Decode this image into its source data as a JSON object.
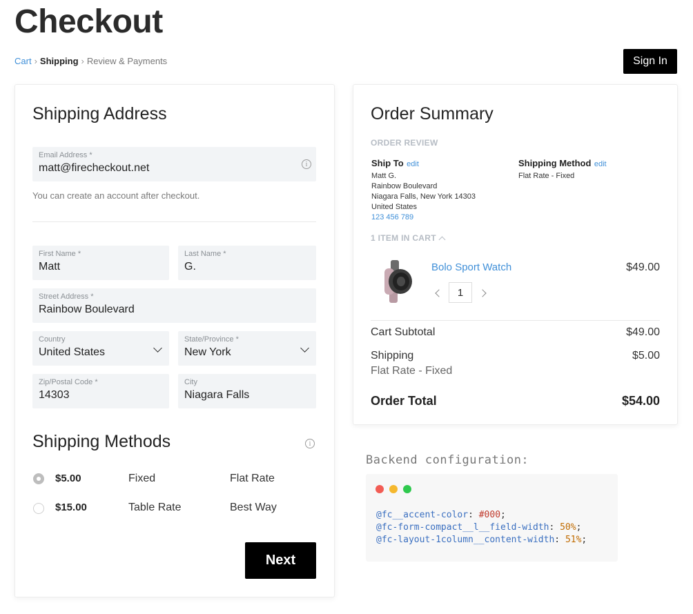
{
  "page": {
    "title": "Checkout",
    "breadcrumb": {
      "cart": "Cart",
      "shipping": "Shipping",
      "review": "Review & Payments",
      "sep": "›"
    },
    "signin_label": "Sign In"
  },
  "shipping_address": {
    "heading": "Shipping Address",
    "email": {
      "label": "Email Address *",
      "value": "matt@firecheckout.net"
    },
    "account_hint": "You can create an account after checkout.",
    "first_name": {
      "label": "First Name *",
      "value": "Matt"
    },
    "last_name": {
      "label": "Last Name *",
      "value": "G."
    },
    "street": {
      "label": "Street Address *",
      "value": "Rainbow Boulevard"
    },
    "country": {
      "label": "Country",
      "value": "United States"
    },
    "state": {
      "label": "State/Province *",
      "value": "New York"
    },
    "zip": {
      "label": "Zip/Postal Code *",
      "value": "14303"
    },
    "city": {
      "label": "City",
      "value": "Niagara Falls"
    }
  },
  "shipping_methods": {
    "heading": "Shipping Methods",
    "methods": [
      {
        "price": "$5.00",
        "method": "Fixed",
        "carrier": "Flat Rate",
        "selected": true
      },
      {
        "price": "$15.00",
        "method": "Table Rate",
        "carrier": "Best Way",
        "selected": false
      }
    ],
    "next_label": "Next"
  },
  "order_summary": {
    "heading": "Order Summary",
    "review_label": "ORDER REVIEW",
    "ship_to": {
      "label": "Ship To",
      "edit": "edit",
      "lines": [
        "Matt G.",
        "Rainbow Boulevard",
        "Niagara Falls, New York 14303",
        "United States"
      ],
      "phone": "123 456 789"
    },
    "shipping_method": {
      "label": "Shipping Method",
      "edit": "edit",
      "value": "Flat Rate - Fixed"
    },
    "items_label": "1 ITEM IN CART",
    "item": {
      "name": "Bolo Sport Watch",
      "price": "$49.00",
      "qty": "1"
    },
    "subtotal": {
      "label": "Cart Subtotal",
      "value": "$49.00"
    },
    "shipping": {
      "label": "Shipping",
      "sub": "Flat Rate - Fixed",
      "value": "$5.00"
    },
    "total": {
      "label": "Order Total",
      "value": "$54.00"
    }
  },
  "backend": {
    "title": "Backend configuration:",
    "lines": [
      {
        "var": "@fc__accent-color",
        "value": "#000"
      },
      {
        "var": "@fc-form-compact__l__field-width",
        "value": "50%"
      },
      {
        "var": "@fc-layout-1column__content-width",
        "value": "51%"
      }
    ],
    "dot_colors": [
      "#f25c54",
      "#f5b82e",
      "#2fc94e"
    ]
  }
}
